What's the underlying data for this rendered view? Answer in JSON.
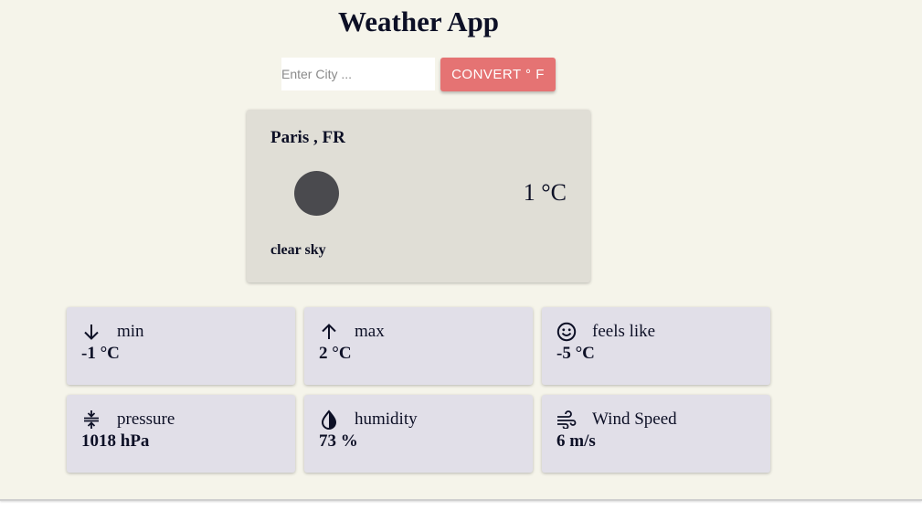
{
  "app": {
    "title": "Weather App"
  },
  "search": {
    "placeholder": "Enter City ...",
    "value": ""
  },
  "toolbar": {
    "convert_label": "CONVERT ° F"
  },
  "current": {
    "location": "Paris , FR",
    "temperature": "1 °C",
    "description": "clear sky",
    "icon": "weather-condition-icon"
  },
  "stats": [
    {
      "icon": "arrow-down-icon",
      "label": "min",
      "value": "-1 °C"
    },
    {
      "icon": "arrow-up-icon",
      "label": "max",
      "value": "2 °C"
    },
    {
      "icon": "smiley-face-icon",
      "label": "feels like",
      "value": "-5 °C"
    },
    {
      "icon": "compress-icon",
      "label": "pressure",
      "value": "1018 hPa"
    },
    {
      "icon": "half-drop-icon",
      "label": "humidity",
      "value": "73 %"
    },
    {
      "icon": "wind-icon",
      "label": "Wind Speed",
      "value": "6 m/s"
    }
  ],
  "colors": {
    "background": "#f5f4ea",
    "accent_button": "#e57373",
    "main_card": "#e0ded6",
    "stat_card": "#e1dfe8",
    "text": "#0d1026"
  }
}
